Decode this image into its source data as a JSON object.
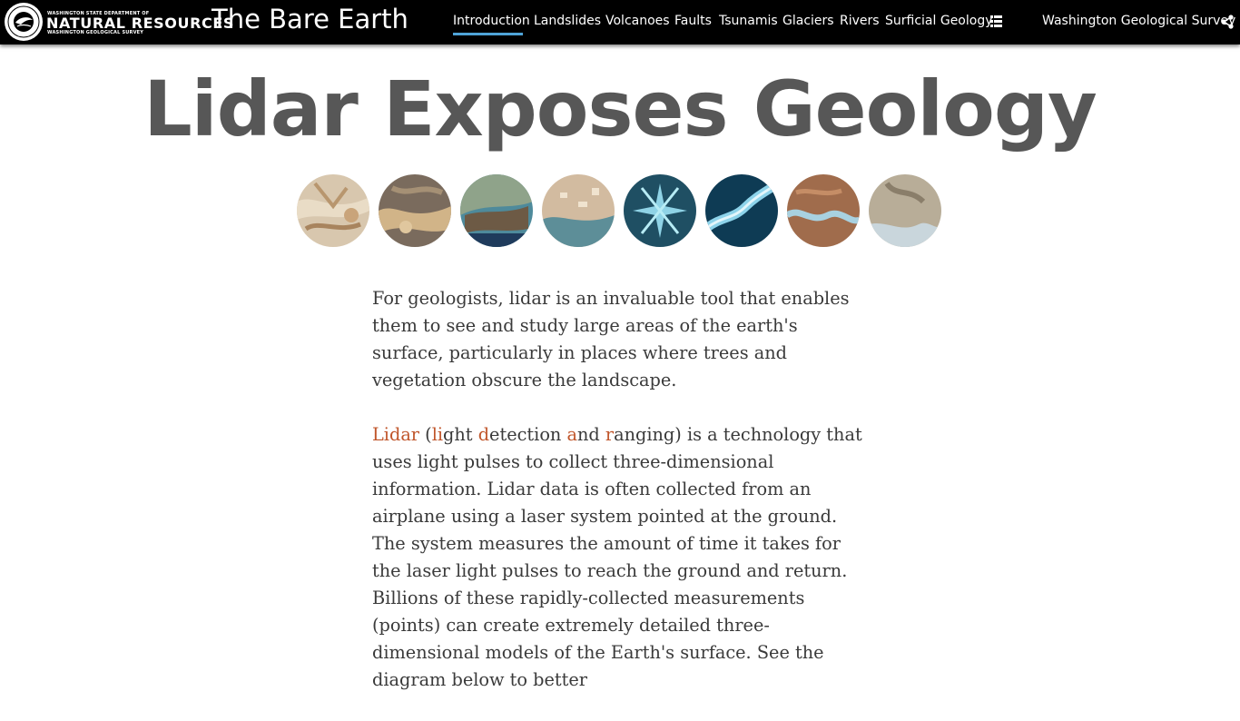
{
  "header": {
    "logo": {
      "line1": "WASHINGTON STATE DEPARTMENT OF",
      "line2": "NATURAL RESOURCES",
      "line3": "WASHINGTON GEOLOGICAL SURVEY",
      "seal_icon": "dnr-seal-icon"
    },
    "site_title": "The Bare Earth",
    "nav": [
      {
        "label": "Introduction",
        "active": true
      },
      {
        "label": "Landslides"
      },
      {
        "label": "Volcanoes"
      },
      {
        "label": "Faults"
      },
      {
        "label": "Tsunamis"
      },
      {
        "label": "Glaciers"
      },
      {
        "label": "Rivers"
      },
      {
        "label": "Surficial Geology"
      }
    ],
    "menu_icon": "list-grid-icon",
    "survey_link": "Washington Geological Survey",
    "share_icon": "share-icon",
    "accent_color": "#4fa3d8"
  },
  "main": {
    "headline": "Lidar Exposes Geology",
    "thumbnails": [
      {
        "name": "landslides-thumbnail"
      },
      {
        "name": "volcanoes-thumbnail"
      },
      {
        "name": "faults-thumbnail"
      },
      {
        "name": "tsunamis-thumbnail"
      },
      {
        "name": "glaciers-thumbnail"
      },
      {
        "name": "rivers-thumbnail"
      },
      {
        "name": "surficial-geology-thumbnail"
      },
      {
        "name": "coast-thumbnail"
      }
    ],
    "paragraph1": "For geologists, lidar is an invaluable tool that enables them to see and study large areas of the earth's surface, particularly in places where trees and vegetation obscure the landscape.",
    "paragraph2": {
      "term": "Lidar",
      "acronym_open": "(",
      "l_letter": "li",
      "l_rest": "ght ",
      "d_letter": "d",
      "d_rest": "etection ",
      "a_letter": "a",
      "a_rest": "nd ",
      "r_letter": "r",
      "r_rest": "anging)",
      "body": " is a technology that uses light pulses to collect three-dimensional information. Lidar data is often collected from an airplane using a laser system pointed at the ground. The system measures the amount of time it takes for the laser light pulses to reach the ground and return. Billions of these rapidly-collected measurements (points) can create extremely detailed three-dimensional models of the Earth's surface. See the diagram below to better"
    },
    "highlight_color": "#c0552a"
  }
}
